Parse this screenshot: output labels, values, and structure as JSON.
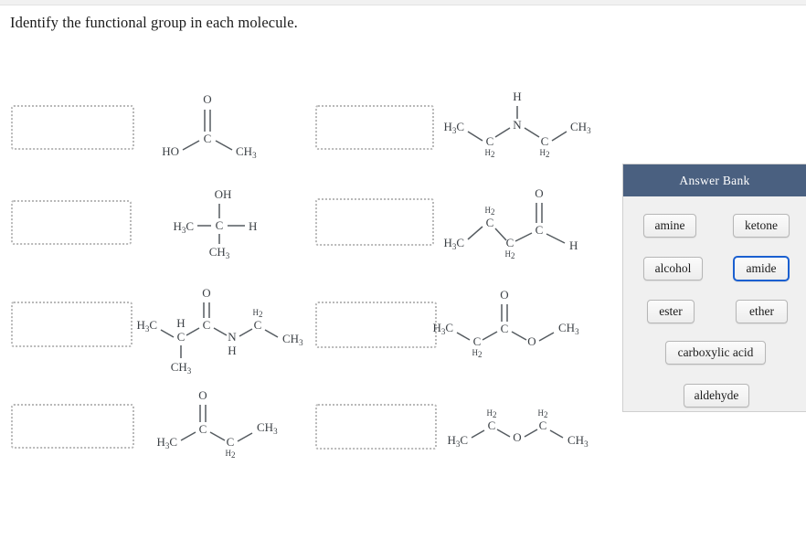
{
  "prompt": "Identify the functional group in each molecule.",
  "answer_bank": {
    "title": "Answer Bank",
    "header_color": "#4a6080",
    "selected_outline_color": "#1a5fd0",
    "chips": [
      {
        "label": "amine",
        "selected": false
      },
      {
        "label": "ketone",
        "selected": false
      },
      {
        "label": "alcohol",
        "selected": false
      },
      {
        "label": "amide",
        "selected": true
      },
      {
        "label": "ester",
        "selected": false
      },
      {
        "label": "ether",
        "selected": false
      },
      {
        "label": "carboxylic acid",
        "selected": false
      },
      {
        "label": "aldehyde",
        "selected": false
      }
    ]
  },
  "dropzones": [
    {
      "id": "dropzone-1",
      "value": "",
      "placeholder": ""
    },
    {
      "id": "dropzone-2",
      "value": "",
      "placeholder": ""
    },
    {
      "id": "dropzone-3",
      "value": "",
      "placeholder": ""
    },
    {
      "id": "dropzone-4",
      "value": "",
      "placeholder": ""
    },
    {
      "id": "dropzone-5",
      "value": "",
      "placeholder": ""
    },
    {
      "id": "dropzone-6",
      "value": "",
      "placeholder": ""
    },
    {
      "id": "dropzone-7",
      "value": "",
      "placeholder": ""
    },
    {
      "id": "dropzone-8",
      "value": "",
      "placeholder": ""
    }
  ],
  "molecules": [
    {
      "id": "molecule-acetic-acid",
      "name": "acetic acid",
      "labels": {
        "ho": "HO",
        "o": "O",
        "c": "C",
        "ch3": "CH",
        "ch3_sub": "3"
      }
    },
    {
      "id": "molecule-diethylamine",
      "name": "diethylamine",
      "labels": {
        "h3c": "H",
        "h3c_sub": "3",
        "h3c_tail": "C",
        "c_left": "C",
        "c_left_sub": "2",
        "h_top": "H",
        "n": "N",
        "c_right": "C",
        "c_right_sub": "2",
        "ch3": "CH",
        "ch3_sub": "3"
      }
    },
    {
      "id": "molecule-isopropanol",
      "name": "isopropanol",
      "labels": {
        "oh": "OH",
        "h3c": "H",
        "h3c_sub": "3",
        "h3c_tail": "C",
        "c": "C",
        "h": "H",
        "ch3": "CH",
        "ch3_sub": "3"
      }
    },
    {
      "id": "molecule-butanal",
      "name": "butanal",
      "labels": {
        "o": "O",
        "h3c": "H",
        "h3c_sub": "3",
        "h3c_tail": "C",
        "c_mid": "C",
        "c_mid_sub": "2",
        "c_low": "C",
        "c_low_sub": "2",
        "c_carbonyl": "C",
        "h": "H"
      }
    },
    {
      "id": "molecule-n-ethyl-2-methylpropanamide",
      "name": "N-ethyl-2-methylpropanamide",
      "labels": {
        "o": "O",
        "h3c": "H",
        "h3c_sub": "3",
        "h3c_tail": "C",
        "ch_h": "H",
        "ch_c": "C",
        "ch3_down": "CH",
        "ch3_down_sub": "3",
        "c_carbonyl": "C",
        "n": "N",
        "n_h": "H",
        "c_eth": "C",
        "c_eth_sub": "2",
        "ch3": "CH",
        "ch3_sub": "3"
      }
    },
    {
      "id": "molecule-methyl-propanoate",
      "name": "methyl propanoate",
      "labels": {
        "o_double": "O",
        "h3c": "H",
        "h3c_sub": "3",
        "h3c_tail": "C",
        "c_mid": "C",
        "c_mid_sub": "2",
        "c_carbonyl": "C",
        "o_single": "O",
        "ch3": "CH",
        "ch3_sub": "3"
      }
    },
    {
      "id": "molecule-butanone",
      "name": "2-butanone",
      "labels": {
        "o": "O",
        "h3c": "H",
        "h3c_sub": "3",
        "h3c_tail": "C",
        "c_carbonyl": "C",
        "c_mid": "C",
        "c_mid_sub": "2",
        "ch3": "CH",
        "ch3_sub": "3"
      }
    },
    {
      "id": "molecule-diethyl-ether",
      "name": "diethyl ether",
      "labels": {
        "h3c": "H",
        "h3c_sub": "3",
        "h3c_tail": "C",
        "c_left": "C",
        "c_left_sub": "2",
        "o": "O",
        "c_right": "C",
        "c_right_sub": "2",
        "ch3": "CH",
        "ch3_sub": "3"
      }
    }
  ]
}
